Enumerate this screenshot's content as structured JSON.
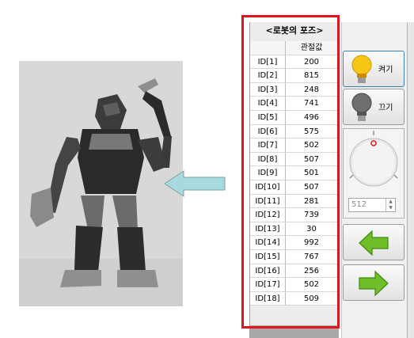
{
  "pose_panel": {
    "title": "<로봇의 포즈>",
    "header_value": "관절값",
    "rows": [
      {
        "id": "ID[1]",
        "value": "200"
      },
      {
        "id": "ID[2]",
        "value": "815"
      },
      {
        "id": "ID[3]",
        "value": "248"
      },
      {
        "id": "ID[4]",
        "value": "741"
      },
      {
        "id": "ID[5]",
        "value": "496"
      },
      {
        "id": "ID[6]",
        "value": "575"
      },
      {
        "id": "ID[7]",
        "value": "502"
      },
      {
        "id": "ID[8]",
        "value": "507"
      },
      {
        "id": "ID[9]",
        "value": "501"
      },
      {
        "id": "ID[10]",
        "value": "507"
      },
      {
        "id": "ID[11]",
        "value": "281"
      },
      {
        "id": "ID[12]",
        "value": "739"
      },
      {
        "id": "ID[13]",
        "value": "30"
      },
      {
        "id": "ID[14]",
        "value": "992"
      },
      {
        "id": "ID[15]",
        "value": "767"
      },
      {
        "id": "ID[16]",
        "value": "256"
      },
      {
        "id": "ID[17]",
        "value": "502"
      },
      {
        "id": "ID[18]",
        "value": "509"
      }
    ]
  },
  "controls": {
    "on_label": "켜기",
    "off_label": "끄기",
    "knob_value": "512",
    "on_icon": "lightbulb-on-icon",
    "off_icon": "lightbulb-off-icon",
    "back_icon": "arrow-left-icon",
    "next_icon": "arrow-right-icon"
  },
  "colors": {
    "highlight": "#e0141e",
    "pointer_arrow": "#a9d9e0",
    "nav_arrow": "#6fbe2a"
  }
}
